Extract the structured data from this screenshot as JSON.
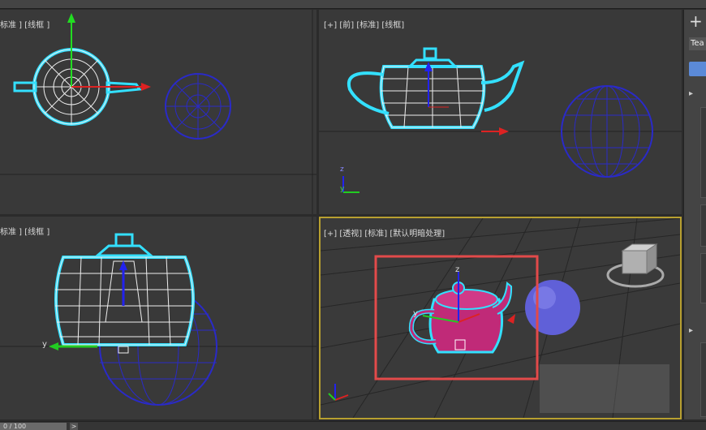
{
  "viewports": {
    "top_left": {
      "label": "标准 ] [线框 ]"
    },
    "top_right": {
      "label": "[+] [前] [标准] [线框]"
    },
    "bottom_left": {
      "label": "标准 ] [线框 ]"
    },
    "bottom_right": {
      "label": "[+] [透视] [标准] [默认明暗处理]"
    }
  },
  "axes": {
    "z": "z",
    "y": "y",
    "x": "x"
  },
  "command_panel": {
    "plus_icon": "+",
    "object_name": "Tea"
  },
  "timeline": {
    "frame": "0 / 100",
    "next": ">"
  },
  "colors": {
    "selection_outline": "#33e0ff",
    "wire": "#e6e6e6",
    "sphere_wire": "#2a2ac8",
    "teapot_shaded": "#c02a78",
    "sphere_shaded": "#6a6ae0",
    "highlight_box": "#e24a4a",
    "active_viewport_border": "#b8a030"
  }
}
